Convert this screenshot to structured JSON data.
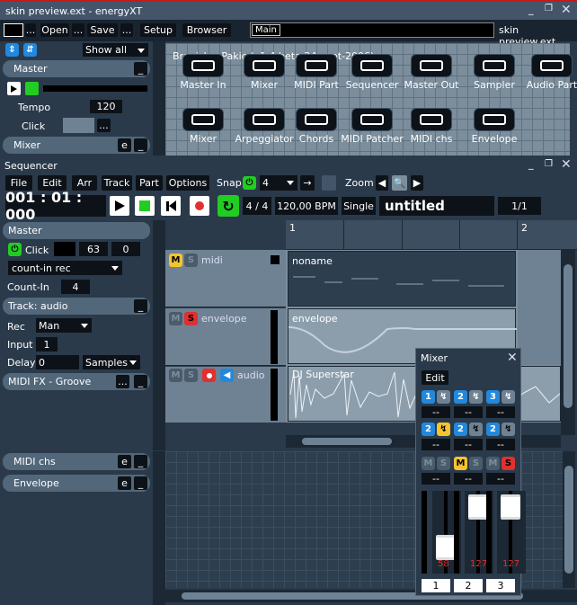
{
  "window": {
    "title": "skin preview.ext - energyXT",
    "minimize": "_",
    "restore": "❐",
    "close": "✕"
  },
  "toolbar": {
    "open": "Open",
    "save": "Save",
    "more1": "...",
    "more2": "...",
    "setup": "Setup",
    "browser": "Browser",
    "main_tab": "Main",
    "file_label": "skin preview.ext"
  },
  "browser": {
    "show_all": "Show all",
    "credit": "Branislav Pakic (v1.4 beta 24-sept-2006)",
    "tools": [
      {
        "label": "Master In",
        "icon": "arrow-in-icon"
      },
      {
        "label": "Mixer",
        "icon": "mixer-icon"
      },
      {
        "label": "MIDI Part",
        "icon": "midi-part-icon"
      },
      {
        "label": "Sequencer",
        "icon": "sequencer-icon"
      },
      {
        "label": "Master Out",
        "icon": "arrow-out-icon"
      },
      {
        "label": "Sampler",
        "icon": "sampler-icon"
      },
      {
        "label": "Audio Part",
        "icon": "wave-icon"
      },
      {
        "label": "Mixer",
        "icon": "mixer-icon"
      },
      {
        "label": "Arpeggiator",
        "icon": "arpeggiator-icon"
      },
      {
        "label": "Chords",
        "icon": "keyboard-icon"
      },
      {
        "label": "MIDI Patcher",
        "icon": "patcher-icon"
      },
      {
        "label": "MIDI chs",
        "icon": "midi-chs-icon"
      },
      {
        "label": "Envelope",
        "icon": "envelope-icon"
      }
    ]
  },
  "left_top": {
    "master": "Master",
    "tempo_label": "Tempo",
    "tempo": "120",
    "click_label": "Click",
    "mixer": "Mixer",
    "e": "e",
    "dash": "_",
    "ellipsis": "..."
  },
  "sequencer": {
    "title": "Sequencer",
    "menu": [
      "File",
      "Edit",
      "Arr",
      "Track",
      "Part",
      "Options"
    ],
    "snap_label": "Snap",
    "snap_value": "4",
    "zoom_label": "Zoom",
    "position": "001 : 01 : 000",
    "signature": "4 / 4",
    "bpm": "120,00 BPM",
    "mode": "Single",
    "song": "untitled",
    "page": "1/1",
    "ruler_1": "1",
    "ruler_2": "2"
  },
  "seq_left": {
    "master": "Master",
    "click": "Click",
    "click_val": "63",
    "click_val2": "0",
    "count_in": "count-in rec",
    "count_in_label": "Count-In",
    "count_in_val": "4",
    "track": "Track: audio",
    "rec_label": "Rec",
    "rec_val": "Man",
    "input_label": "Input",
    "input_val": "1",
    "delay_label": "Delay",
    "delay_val": "0",
    "delay_unit": "Samples",
    "midifx": "MIDI FX - Groove"
  },
  "tracks": [
    {
      "name": "midi",
      "part": "noname",
      "m": "M",
      "s": "S"
    },
    {
      "name": "envelope",
      "part": "envelope",
      "m": "M",
      "s": "S"
    },
    {
      "name": "audio",
      "part": "DJ Superstar",
      "m": "M",
      "s": "S"
    }
  ],
  "bottom": {
    "midi_chs": "MIDI chs",
    "envelope": "Envelope"
  },
  "mixer": {
    "title": "Mixer",
    "edit": "Edit",
    "dash": "--",
    "channels": [
      {
        "num": "1",
        "level": "58",
        "fader": 0.3
      },
      {
        "num": "2",
        "level": "127",
        "fader": 0.95
      },
      {
        "num": "3",
        "level": "127",
        "fader": 0.95
      }
    ],
    "m": "M",
    "s": "S"
  },
  "colors": {
    "yellow": "#f4c430",
    "red": "#e03030",
    "green": "#22cc22",
    "blue": "#2288dd"
  }
}
